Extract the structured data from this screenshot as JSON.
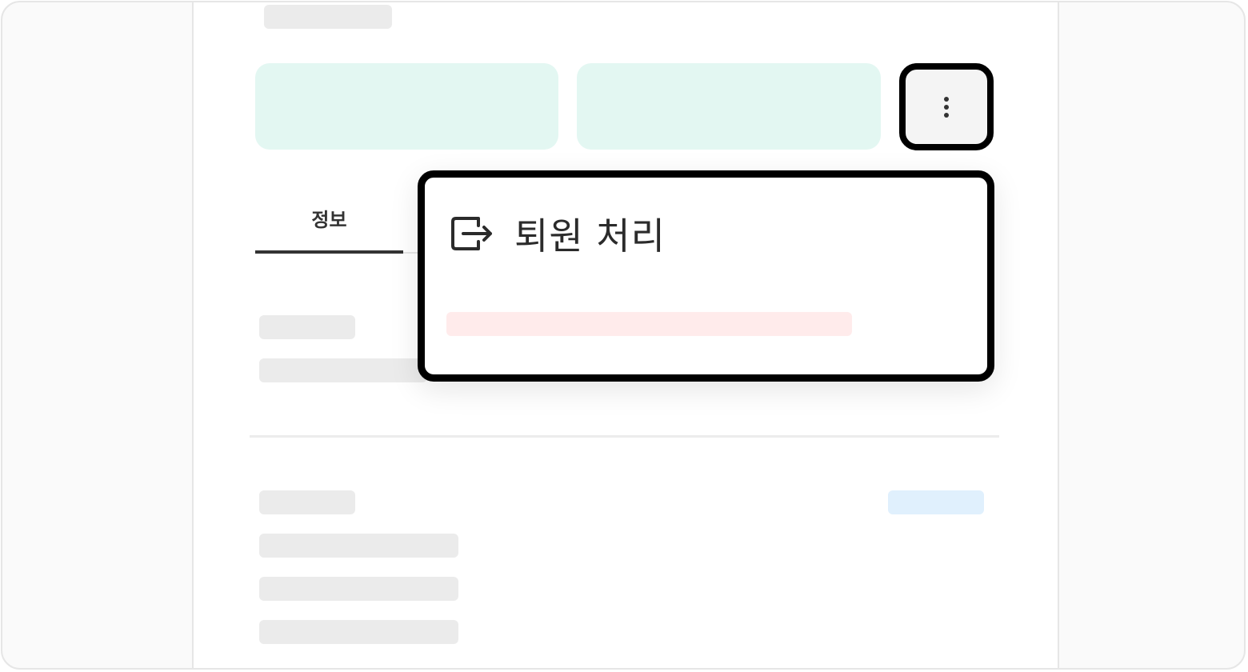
{
  "profile": {
    "tabs": [
      {
        "label": "정보",
        "active": true
      }
    ]
  },
  "more_menu": {
    "items": [
      {
        "label": "퇴원 처리",
        "icon": "exit-icon"
      }
    ]
  },
  "colors": {
    "accent_mint": "#e3f7f2",
    "danger_pink": "#ffebeb",
    "info_blue": "#e0f0fd",
    "skeleton_gray": "#ebebeb",
    "highlight_border": "#000000"
  }
}
